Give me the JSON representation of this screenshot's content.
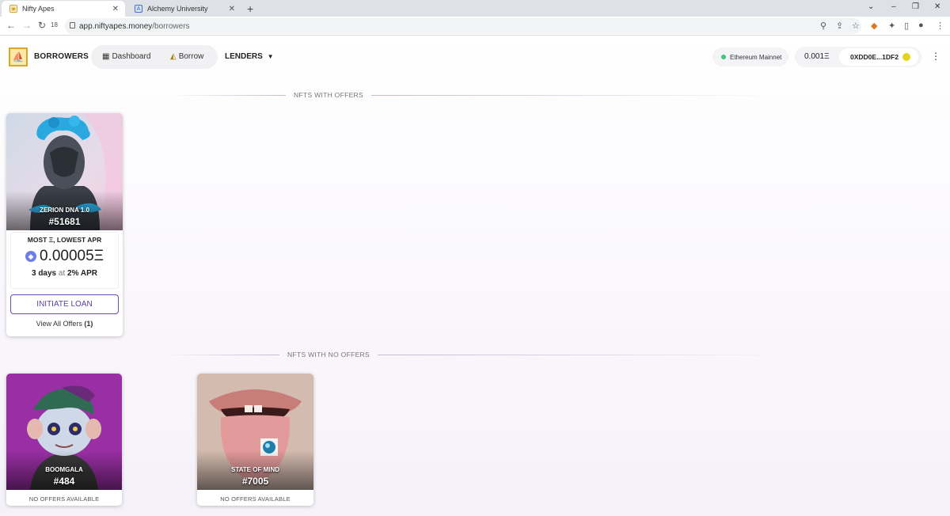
{
  "browser": {
    "tabs": [
      {
        "title": "Nifty Apes",
        "active": true
      },
      {
        "title": "Alchemy University",
        "active": false
      }
    ],
    "new_tab": "+",
    "url_domain": "app.niftyapes.money",
    "url_path": "/borrowers",
    "tab_count_badge": "18"
  },
  "header": {
    "brand": "BORROWERS",
    "nav": [
      {
        "label": "Dashboard",
        "icon": "chart-icon"
      },
      {
        "label": "Borrow",
        "icon": "borrow-icon"
      }
    ],
    "lenders_label": "LENDERS",
    "network": "Ethereum Mainnet",
    "balance": "0.001Ξ",
    "address": "0XDD0E...1DF2"
  },
  "sections": {
    "with_offers": "NFTS WITH OFFERS",
    "no_offers": "NFTS WITH NO OFFERS"
  },
  "offer_card": {
    "collection": "ZERION DNA 1.0",
    "token_id": "#51681",
    "best_label": "MOST Ξ, LOWEST APR",
    "amount": "0.00005Ξ",
    "duration": "3 days",
    "at": "at",
    "apr": "2% APR",
    "button": "INITIATE LOAN",
    "view_all": "View All Offers",
    "offer_count": "(1)"
  },
  "no_offer_cards": [
    {
      "collection": "BOOMGALA",
      "token_id": "#484",
      "status": "NO OFFERS AVAILABLE"
    },
    {
      "collection": "STATE OF MIND",
      "token_id": "#7005",
      "status": "NO OFFERS AVAILABLE"
    }
  ],
  "colors": {
    "accent": "#5a3fa0",
    "network_dot": "#3ec77a",
    "logo": "#d9a52a"
  }
}
